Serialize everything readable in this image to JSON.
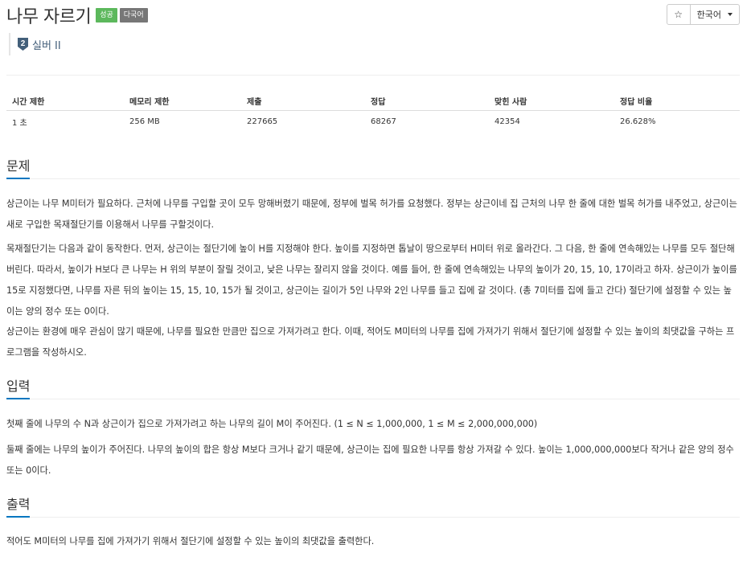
{
  "header": {
    "title": "나무 자르기",
    "badge_success": "성공",
    "badge_lang": "다국어",
    "star_icon": "☆",
    "language_button": "한국어",
    "tier_icon_number": "2",
    "tier": "실버 II",
    "tier_color": "#435f7a"
  },
  "info_table": {
    "headers": [
      "시간 제한",
      "메모리 제한",
      "제출",
      "정답",
      "맞힌 사람",
      "정답 비율"
    ],
    "values": [
      "1 초",
      "256 MB",
      "227665",
      "68267",
      "42354",
      "26.628%"
    ]
  },
  "sections": {
    "problem": {
      "heading": "문제",
      "paragraphs": [
        "상근이는 나무 M미터가 필요하다. 근처에 나무를 구입할 곳이 모두 망해버렸기 때문에, 정부에 벌목 허가를 요청했다. 정부는 상근이네 집 근처의 나무 한 줄에 대한 벌목 허가를 내주었고, 상근이는 새로 구입한 목재절단기를 이용해서 나무를 구할것이다.",
        "목재절단기는 다음과 같이 동작한다. 먼저, 상근이는 절단기에 높이 H를 지정해야 한다. 높이를 지정하면 톱날이 땅으로부터 H미터 위로 올라간다. 그 다음, 한 줄에 연속해있는 나무를 모두 절단해버린다. 따라서, 높이가 H보다 큰 나무는 H 위의 부분이 잘릴 것이고, 낮은 나무는 잘리지 않을 것이다. 예를 들어, 한 줄에 연속해있는 나무의 높이가 20, 15, 10, 17이라고 하자. 상근이가 높이를 15로 지정했다면, 나무를 자른 뒤의 높이는 15, 15, 10, 15가 될 것이고, 상근이는 길이가 5인 나무와 2인 나무를 들고 집에 갈 것이다. (총 7미터를 집에 들고 간다) 절단기에 설정할 수 있는 높이는 양의 정수 또는 0이다.",
        "상근이는 환경에 매우 관심이 많기 때문에, 나무를 필요한 만큼만 집으로 가져가려고 한다. 이때, 적어도 M미터의 나무를 집에 가져가기 위해서 절단기에 설정할 수 있는 높이의 최댓값을 구하는 프로그램을 작성하시오."
      ]
    },
    "input": {
      "heading": "입력",
      "paragraphs": [
        "첫째 줄에 나무의 수 N과 상근이가 집으로 가져가려고 하는 나무의 길이 M이 주어진다. (1 ≤ N ≤ 1,000,000, 1 ≤ M ≤ 2,000,000,000)",
        "둘째 줄에는 나무의 높이가 주어진다. 나무의 높이의 합은 항상 M보다 크거나 같기 때문에, 상근이는 집에 필요한 나무를 항상 가져갈 수 있다. 높이는 1,000,000,000보다 작거나 같은 양의 정수 또는 0이다."
      ]
    },
    "output": {
      "heading": "출력",
      "paragraphs": [
        "적어도 M미터의 나무를 집에 가져가기 위해서 절단기에 설정할 수 있는 높이의 최댓값을 출력한다."
      ]
    }
  }
}
